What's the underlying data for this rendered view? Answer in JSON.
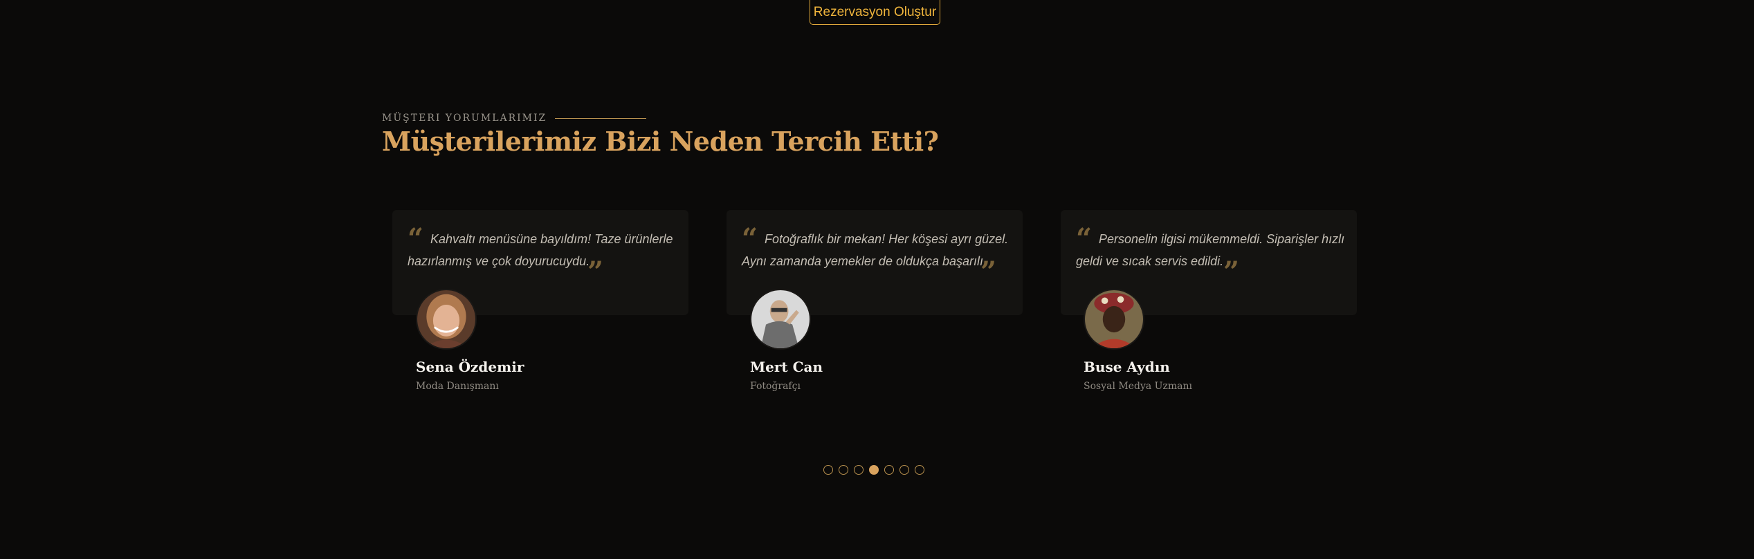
{
  "cta": {
    "label": "Rezervasyon Oluştur"
  },
  "section": {
    "eyebrow": "MÜŞTERI YORUMLARIMIZ",
    "title": "Müşterilerimiz Bizi Neden Tercih Etti?"
  },
  "testimonials": [
    {
      "text": "Kahvaltı menüsüne bayıldım! Taze ürünlerle hazırlanmış ve çok doyurucuydu.",
      "name": "Sena Özdemir",
      "role": "Moda Danışmanı"
    },
    {
      "text": "Fotoğraflık bir mekan! Her köşesi ayrı güzel. Aynı zamanda yemekler de oldukça başarılı.",
      "name": "Mert Can",
      "role": "Fotoğrafçı"
    },
    {
      "text": "Personelin ilgisi mükemmeldi. Siparişler hızlı geldi ve sıcak servis edildi.",
      "name": "Buse Aydın",
      "role": "Sosyal Medya Uzmanı"
    }
  ],
  "pagination": {
    "count": 7,
    "active_index": 3
  },
  "icons": {
    "quote": "quote-icon"
  },
  "colors": {
    "accent": "#d9a35e",
    "cta": "#f0b53c",
    "background": "#0b0a09",
    "card": "#141311"
  }
}
